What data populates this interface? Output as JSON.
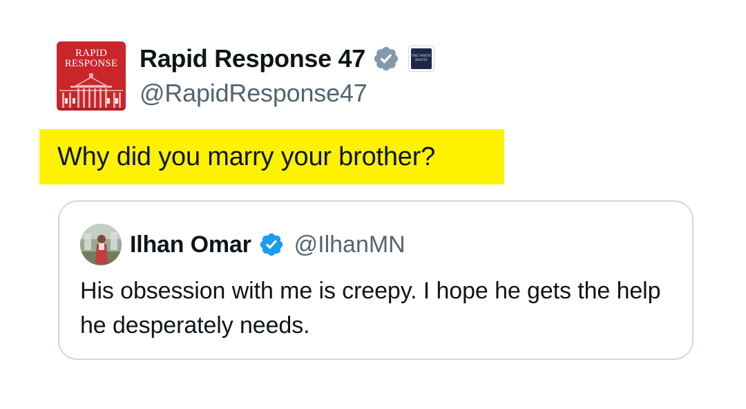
{
  "author": {
    "display_name": "Rapid Response 47",
    "handle": "@RapidResponse47",
    "avatar": {
      "icon": "rapid-response-whitehouse-logo",
      "logo_line1": "RAPID",
      "logo_line2": "RESPONSE",
      "background": "#c9252b"
    },
    "badge": {
      "icon": "gray-verified-badge-icon",
      "color": "#829aab"
    },
    "affiliation": {
      "icon": "white-house-affiliate-icon",
      "text": "THE WHITE HOUSE"
    }
  },
  "tweet": {
    "text": "Why did you marry your brother?",
    "highlight_color": "#fff200"
  },
  "quoted_tweet": {
    "author": {
      "display_name": "Ilhan Omar",
      "handle": "@IlhanMN",
      "avatar": {
        "icon": "profile-photo-avatar"
      },
      "badge": {
        "icon": "blue-verified-badge-icon",
        "color": "#1d9bf0"
      }
    },
    "text": "His obsession with me is creepy. I hope he gets the help he desperately needs."
  },
  "colors": {
    "text_primary": "#0f1419",
    "text_secondary": "#536471",
    "border": "#cfd9de"
  }
}
